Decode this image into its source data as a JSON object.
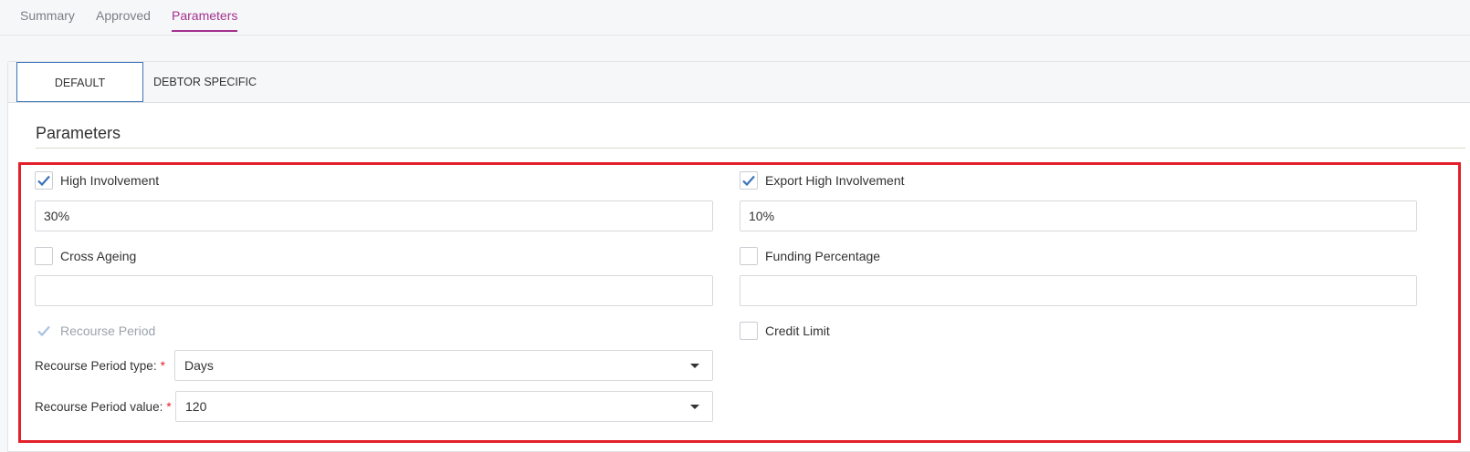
{
  "top_tabs": [
    {
      "label": "Summary",
      "active": false
    },
    {
      "label": "Approved",
      "active": false
    },
    {
      "label": "Parameters",
      "active": true
    }
  ],
  "sub_tabs": [
    {
      "label": "DEFAULT",
      "active": true
    },
    {
      "label": "DEBTOR SPECIFIC",
      "active": false
    }
  ],
  "section": {
    "title": "Parameters"
  },
  "fields": {
    "high_involvement": {
      "label": "High Involvement",
      "checked": true,
      "value": "30%"
    },
    "export_high_involvement": {
      "label": "Export High Involvement",
      "checked": true,
      "value": "10%"
    },
    "cross_ageing": {
      "label": "Cross Ageing",
      "checked": false,
      "value": ""
    },
    "funding_percentage": {
      "label": "Funding Percentage",
      "checked": false,
      "value": ""
    },
    "recourse_period": {
      "label": "Recourse Period",
      "checked": true,
      "disabled": true
    },
    "credit_limit": {
      "label": "Credit Limit",
      "checked": false
    },
    "recourse_period_type": {
      "label": "Recourse Period type:",
      "required_mark": "*",
      "value": "Days"
    },
    "recourse_period_value": {
      "label": "Recourse Period value:",
      "required_mark": "*",
      "value": "120"
    }
  },
  "colors": {
    "accent_tab": "#a3318f",
    "check": "#3b73b9",
    "highlight": "#e3202a"
  },
  "icons": {
    "check": "checkmark-icon",
    "dropdown": "caret-down-icon"
  }
}
